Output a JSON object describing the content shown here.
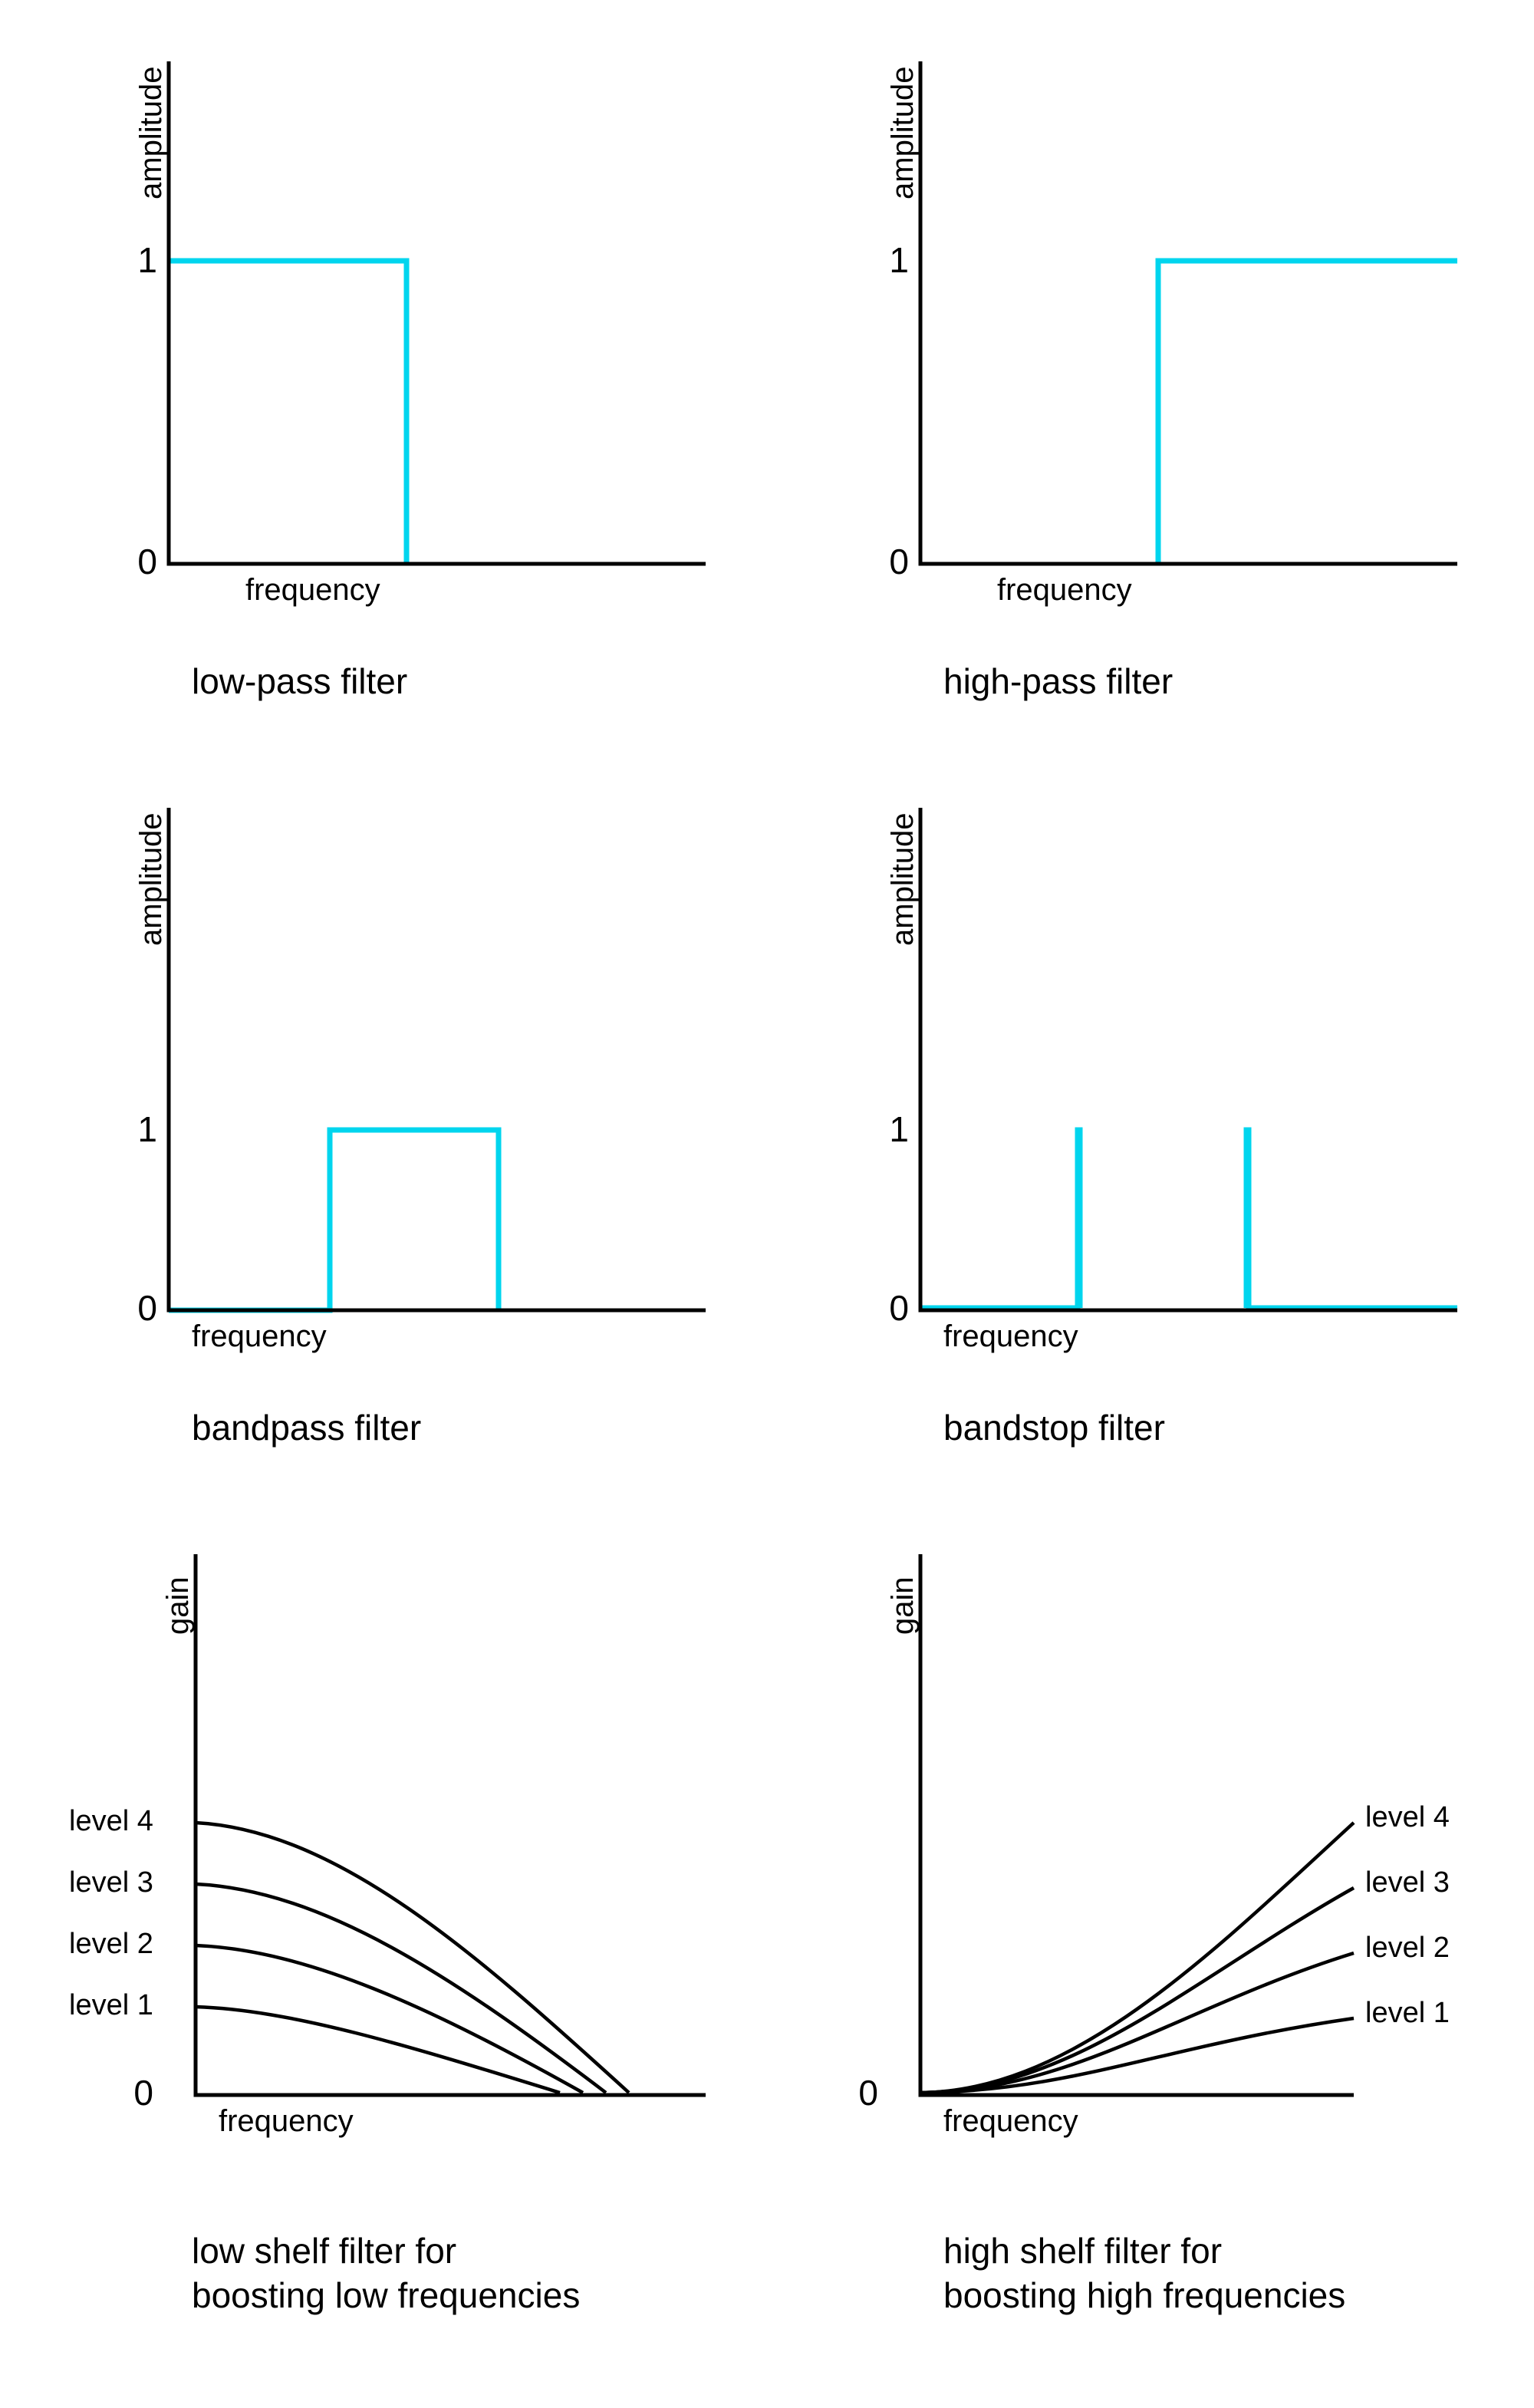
{
  "chart_data": [
    {
      "id": "lowpass",
      "type": "line",
      "title": "low-pass filter",
      "xlabel": "frequency",
      "ylabel": "amplitude",
      "yticks": [
        0,
        1
      ],
      "ylim": [
        0,
        1.2
      ],
      "xlim": [
        0,
        1
      ],
      "series": [
        {
          "name": "response",
          "x": [
            0,
            0.5,
            0.5,
            1
          ],
          "values": [
            1,
            1,
            0,
            0
          ]
        }
      ]
    },
    {
      "id": "highpass",
      "type": "line",
      "title": "high-pass filter",
      "xlabel": "frequency",
      "ylabel": "amplitude",
      "yticks": [
        0,
        1
      ],
      "ylim": [
        0,
        1.2
      ],
      "xlim": [
        0,
        1
      ],
      "series": [
        {
          "name": "response",
          "x": [
            0,
            0.5,
            0.5,
            1
          ],
          "values": [
            0,
            0,
            1,
            1
          ]
        }
      ]
    },
    {
      "id": "bandpass",
      "type": "line",
      "title": "bandpass filter",
      "xlabel": "frequency",
      "ylabel": "amplitude",
      "yticks": [
        0,
        1
      ],
      "ylim": [
        0,
        1.2
      ],
      "xlim": [
        0,
        1
      ],
      "series": [
        {
          "name": "response",
          "x": [
            0,
            0.3,
            0.3,
            0.62,
            0.62,
            1
          ],
          "values": [
            0,
            0,
            1,
            1,
            0,
            0
          ]
        }
      ]
    },
    {
      "id": "bandstop",
      "type": "line",
      "title": "bandstop filter",
      "xlabel": "frequency",
      "ylabel": "amplitude",
      "yticks": [
        0,
        1
      ],
      "ylim": [
        0,
        1.2
      ],
      "xlim": [
        0,
        1
      ],
      "series": [
        {
          "name": "response",
          "x": [
            0,
            0.28,
            0.28,
            0.28,
            0.6,
            0.6,
            0.6,
            1
          ],
          "values": [
            0,
            0,
            1,
            0,
            0,
            1,
            0,
            0
          ]
        }
      ]
    },
    {
      "id": "lowshelf",
      "type": "line",
      "title": "low shelf filter for\nboosting low frequencies",
      "xlabel": "frequency",
      "ylabel": "gain",
      "yticks": [
        0
      ],
      "ylim": [
        0,
        1.2
      ],
      "xlim": [
        0,
        1
      ],
      "series": [
        {
          "name": "level 1",
          "x": [
            0,
            0.15,
            0.3,
            0.45,
            0.6,
            0.75,
            0.9,
            1
          ],
          "values": [
            0.22,
            0.21,
            0.18,
            0.12,
            0.06,
            0.02,
            0.005,
            0
          ]
        },
        {
          "name": "level 2",
          "x": [
            0,
            0.15,
            0.3,
            0.45,
            0.6,
            0.75,
            0.9,
            1
          ],
          "values": [
            0.44,
            0.42,
            0.36,
            0.24,
            0.12,
            0.04,
            0.01,
            0
          ]
        },
        {
          "name": "level 3",
          "x": [
            0,
            0.15,
            0.3,
            0.45,
            0.6,
            0.75,
            0.9,
            1
          ],
          "values": [
            0.66,
            0.63,
            0.54,
            0.36,
            0.18,
            0.06,
            0.015,
            0
          ]
        },
        {
          "name": "level 4",
          "x": [
            0,
            0.15,
            0.3,
            0.45,
            0.6,
            0.75,
            0.9,
            1
          ],
          "values": [
            0.88,
            0.84,
            0.72,
            0.48,
            0.24,
            0.08,
            0.02,
            0
          ]
        }
      ],
      "level_labels": [
        "level 1",
        "level 2",
        "level 3",
        "level 4"
      ]
    },
    {
      "id": "highshelf",
      "type": "line",
      "title": "high shelf filter for\nboosting high frequencies",
      "xlabel": "frequency",
      "ylabel": "gain",
      "yticks": [
        0
      ],
      "ylim": [
        0,
        1.2
      ],
      "xlim": [
        0,
        1
      ],
      "series": [
        {
          "name": "level 1",
          "x": [
            0,
            0.1,
            0.25,
            0.4,
            0.55,
            0.7,
            0.85,
            1
          ],
          "values": [
            0,
            0.005,
            0.02,
            0.06,
            0.12,
            0.18,
            0.21,
            0.22
          ]
        },
        {
          "name": "level 2",
          "x": [
            0,
            0.1,
            0.25,
            0.4,
            0.55,
            0.7,
            0.85,
            1
          ],
          "values": [
            0,
            0.01,
            0.04,
            0.12,
            0.24,
            0.36,
            0.42,
            0.44
          ]
        },
        {
          "name": "level 3",
          "x": [
            0,
            0.1,
            0.25,
            0.4,
            0.55,
            0.7,
            0.85,
            1
          ],
          "values": [
            0,
            0.015,
            0.06,
            0.18,
            0.36,
            0.54,
            0.63,
            0.66
          ]
        },
        {
          "name": "level 4",
          "x": [
            0,
            0.1,
            0.25,
            0.4,
            0.55,
            0.7,
            0.85,
            1
          ],
          "values": [
            0,
            0.02,
            0.08,
            0.24,
            0.48,
            0.72,
            0.84,
            0.88
          ]
        }
      ],
      "level_labels": [
        "level 1",
        "level 2",
        "level 3",
        "level 4"
      ]
    }
  ],
  "captions": {
    "lowpass": "low-pass filter",
    "highpass": "high-pass filter",
    "bandpass": "bandpass filter",
    "bandstop": "bandstop filter",
    "lowshelf": "low shelf filter for\nboosting low frequencies",
    "highshelf": "high shelf filter for\nboosting high frequencies"
  },
  "axis": {
    "ylabel_amp": "amplitude",
    "ylabel_gain": "gain",
    "xlabel": "frequency",
    "tick0": "0",
    "tick1": "1"
  },
  "levels": {
    "l1": "level 1",
    "l2": "level 2",
    "l3": "level 3",
    "l4": "level 4"
  }
}
